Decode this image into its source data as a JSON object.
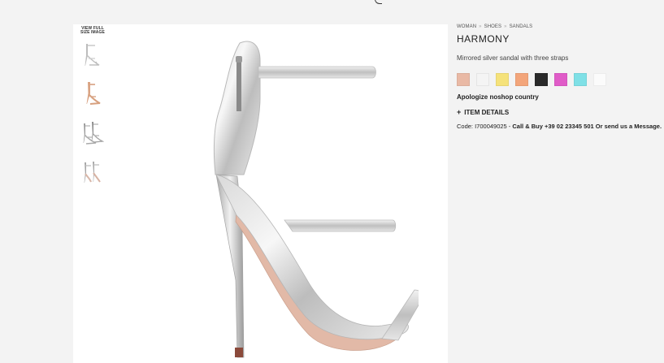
{
  "breadcrumb": {
    "items": [
      "WOMAN",
      "SHOES",
      "SANDALS"
    ],
    "separator": "»"
  },
  "product": {
    "title": "HARMONY",
    "subtitle": "Mirrored silver sandal with three straps",
    "notice": "Apologize noshop country",
    "details_label": "ITEM DETAILS",
    "details_icon": "plus-icon",
    "code_prefix": "Code: I700049025 - ",
    "contact": "Call & Buy +39 02 23345 501 Or send us a Message."
  },
  "gallery": {
    "view_full_line1": "VIEW FULL",
    "view_full_line2": "SIZE IMAGE",
    "thumbnails": [
      "silver-side-view",
      "nude-side-view",
      "silver-pair-view",
      "silver-back-view"
    ]
  },
  "swatches": [
    {
      "name": "nude",
      "color": "#e9b9a5"
    },
    {
      "name": "white",
      "color": "#f4f4f4"
    },
    {
      "name": "gold",
      "color": "#f5e27a"
    },
    {
      "name": "peach",
      "color": "#f3a57a"
    },
    {
      "name": "black",
      "color": "#2a2a2a"
    },
    {
      "name": "fuchsia",
      "color": "#e05cc8"
    },
    {
      "name": "turquoise",
      "color": "#7fe0e6"
    },
    {
      "name": "white-light",
      "color": "#fbfbfb"
    }
  ]
}
